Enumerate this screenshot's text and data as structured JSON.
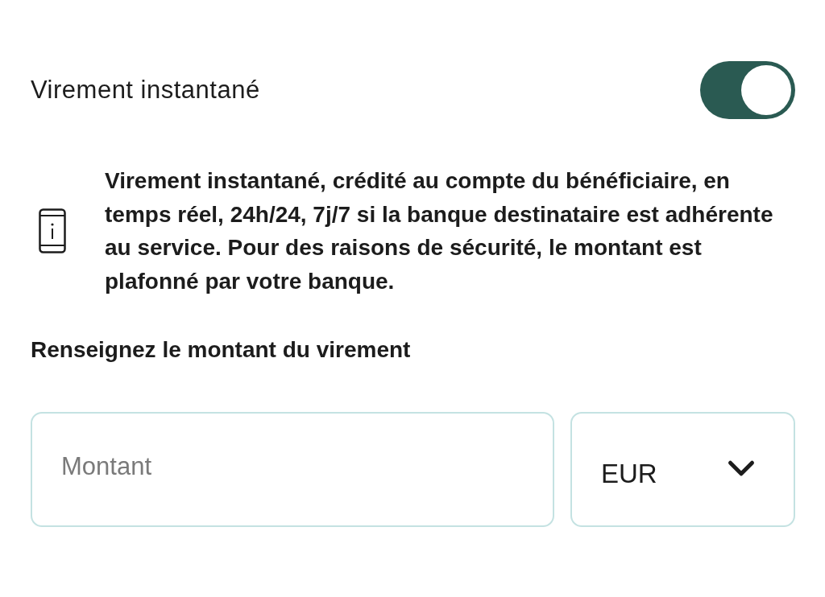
{
  "instant_transfer": {
    "label": "Virement instantané",
    "on": true
  },
  "info": {
    "text": "Virement instantané, crédité au compte du bénéficiaire, en temps réel, 24h/24, 7j/7 si la banque destinataire est adhérente au service. Pour des raisons de sécurité, le montant est plafonné par votre banque."
  },
  "amount_section": {
    "heading": "Renseignez le montant du virement",
    "amount_field": {
      "placeholder": "Montant"
    },
    "currency_select": {
      "value": "EUR"
    }
  }
}
